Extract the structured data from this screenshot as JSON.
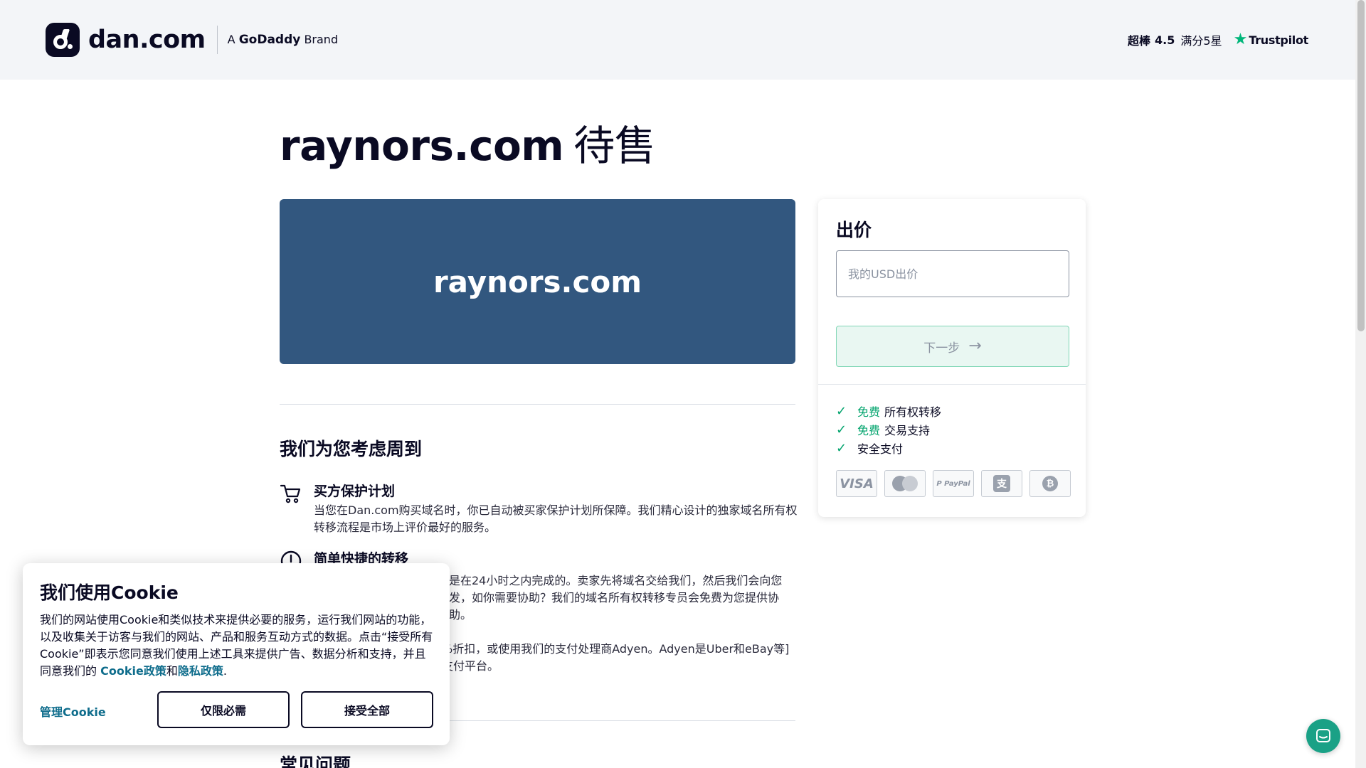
{
  "header": {
    "logo_text": "dan.com",
    "brand_prefix": "A",
    "brand_name": "GoDaddy",
    "brand_suffix": "Brand",
    "rating_label": "超棒",
    "rating_score": "4.5",
    "rating_suffix": "满分5星",
    "trustpilot": "Trustpilot"
  },
  "main": {
    "domain": "raynors.com",
    "for_sale": "待售",
    "section_title": "我们为您考虑周到",
    "features": [
      {
        "icon": "cart-icon",
        "title": "买方保护计划",
        "body": "当您在Dan.com购买域名时，你已自动被买家保护计划所保障。我们精心设计的独家域名所有权转移流程是市场上评价最好的服务。"
      },
      {
        "icon": "clock-icon",
        "title": "简单快捷的转移",
        "body": "是在24小时之内完成的。卖家先将域名交给我们，然后我们会向您发，如你需要协助？我们的域名所有权转移专员会免费为您提供协助。"
      },
      {
        "icon": "card-icon",
        "title": "",
        "body": "%折扣，或使用我们的支付处理商Adyen。Adyen是Uber和eBay等]支付平台。"
      }
    ],
    "faq_title": "常见问题"
  },
  "offer": {
    "title": "出价",
    "input_placeholder": "我的USD出价",
    "input_value": "",
    "next_label": "下一步",
    "benefits": [
      {
        "free": "免费",
        "text": "所有权转移"
      },
      {
        "free": "免费",
        "text": "交易支持"
      },
      {
        "free": "",
        "text": "安全支付"
      }
    ],
    "payment_methods": [
      "VISA",
      "Mastercard",
      "PayPal",
      "Alipay",
      "Bitcoin"
    ],
    "paypal_text": "P PayPal"
  },
  "cookie": {
    "title": "我们使用Cookie",
    "text": "我们的网站使用Cookie和类似技术来提供必要的服务，运行我们网站的功能，以及收集关于访客与我们的网站、产品和服务互动方式的数据。点击“接受所有Cookie”即表示您同意我们使用上述工具来提供广告、数据分析和支持，并且同意我们的",
    "cookie_policy": "Cookie政策",
    "and": "和",
    "privacy_policy": "隐私政策",
    "period": ".",
    "manage_label": "管理Cookie",
    "necessary_label": "仅限必需",
    "accept_all_label": "接受全部"
  },
  "colors": {
    "banner_bg": "#32577f",
    "accent_green": "#00a36c",
    "link_teal": "#0f6d8c",
    "trustpilot_star": "#00b67a",
    "chat_bg": "#1aa186"
  }
}
